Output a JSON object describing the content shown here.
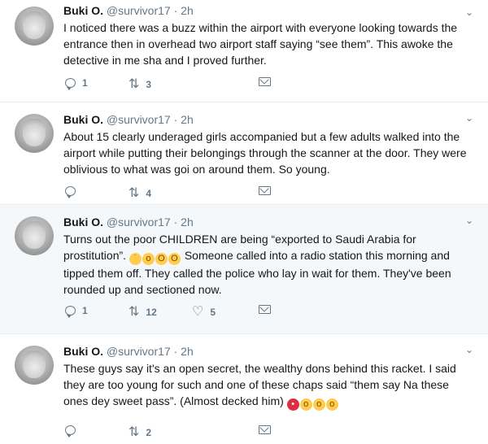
{
  "tweets": [
    {
      "name": "Buki O.",
      "handle": "@survivor17",
      "dot": "·",
      "time": "2h",
      "text_parts": [
        "I noticed there was a buzz within the airport with everyone looking towards the entrance then in overhead two airport staff saying “see them”. This awoke the detective in me sha and I proved further."
      ],
      "replies": "1",
      "retweets": "3",
      "likes": ""
    },
    {
      "name": "Buki O.",
      "handle": "@survivor17",
      "dot": "·",
      "time": "2h",
      "text_parts": [
        "About 15 clearly underaged girls accompanied but a few adults walked into the airport while putting their belongings through the scanner at the door. They were oblivious to what was goi on around them. So young."
      ],
      "replies": "",
      "retweets": "4",
      "likes": ""
    },
    {
      "name": "Buki O.",
      "handle": "@survivor17",
      "dot": "·",
      "time": "2h",
      "text_parts": [
        "Turns out the poor CHILDREN are being “exported to Saudi Arabia for prostitution”.",
        "Someone called into a radio station this morning and tipped them off. They called the police who lay in wait for them. They've been rounded up and sectioned now."
      ],
      "replies": "1",
      "retweets": "12",
      "likes": "5"
    },
    {
      "name": "Buki O.",
      "handle": "@survivor17",
      "dot": "·",
      "time": "2h",
      "text_parts": [
        "These guys say it's an open secret, the wealthy dons behind this racket. I said they are too young for such and one of these chaps said “them say Na these ones dey sweet pass”. (Almost decked him)"
      ],
      "replies": "",
      "retweets": "2",
      "likes": ""
    }
  ],
  "icons": {
    "reply": "reply-icon",
    "retweet": "retweet-icon",
    "like": "heart-icon",
    "dm": "envelope-icon",
    "caret": "chevron-down-icon",
    "emoji_set_1": [
      "flushed-face",
      "astonished-face",
      "scream-face",
      "scream-face"
    ],
    "emoji_set_2": [
      "angry-face",
      "crying-face",
      "crying-face",
      "crying-face"
    ]
  },
  "colors": {
    "muted": "#657786",
    "text": "#14171a",
    "highlight_bg": "#f5f8fa"
  }
}
